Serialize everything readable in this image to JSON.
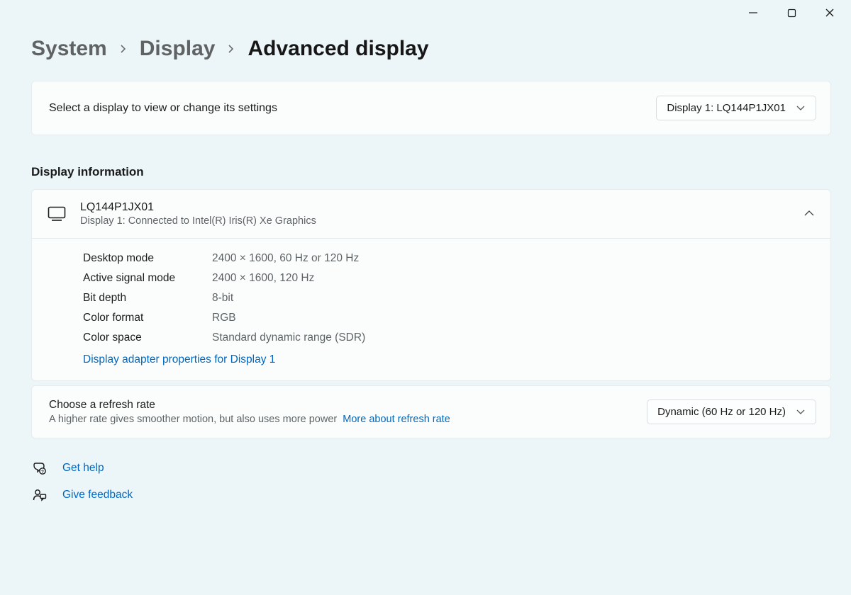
{
  "window": {
    "minimize": "—",
    "maximize": "▢",
    "close": "✕"
  },
  "breadcrumb": {
    "system": "System",
    "display": "Display",
    "current": "Advanced display"
  },
  "select_display": {
    "label": "Select a display to view or change its settings",
    "selected": "Display 1: LQ144P1JX01"
  },
  "display_info": {
    "section_title": "Display information",
    "name": "LQ144P1JX01",
    "subtitle": "Display 1: Connected to Intel(R) Iris(R) Xe Graphics",
    "rows": [
      {
        "label": "Desktop mode",
        "value": "2400 × 1600, 60 Hz or 120 Hz"
      },
      {
        "label": "Active signal mode",
        "value": "2400 × 1600, 120 Hz"
      },
      {
        "label": "Bit depth",
        "value": "8-bit"
      },
      {
        "label": "Color format",
        "value": "RGB"
      },
      {
        "label": "Color space",
        "value": "Standard dynamic range (SDR)"
      }
    ],
    "adapter_link": "Display adapter properties for Display 1"
  },
  "refresh_rate": {
    "title": "Choose a refresh rate",
    "subtitle": "A higher rate gives smoother motion, but also uses more power",
    "more_link": "More about refresh rate",
    "selected": "Dynamic (60 Hz or 120 Hz)"
  },
  "footer": {
    "get_help": "Get help",
    "give_feedback": "Give feedback"
  }
}
